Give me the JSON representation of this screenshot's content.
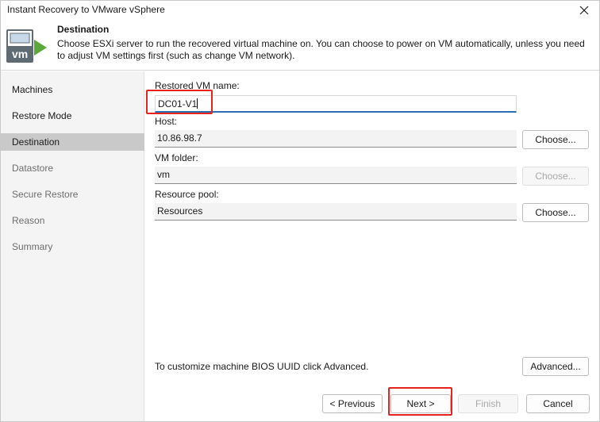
{
  "window": {
    "title": "Instant Recovery to VMware vSphere"
  },
  "header": {
    "title": "Destination",
    "description": "Choose ESXi server to run the recovered virtual machine on. You can choose to power on VM automatically, unless you need to adjust VM settings first (such as change VM network).",
    "icon": "vm-icon"
  },
  "sidebar": {
    "items": [
      {
        "label": "Machines",
        "state": "normal"
      },
      {
        "label": "Restore Mode",
        "state": "normal"
      },
      {
        "label": "Destination",
        "state": "active"
      },
      {
        "label": "Datastore",
        "state": "disabled"
      },
      {
        "label": "Secure Restore",
        "state": "disabled"
      },
      {
        "label": "Reason",
        "state": "disabled"
      },
      {
        "label": "Summary",
        "state": "disabled"
      }
    ]
  },
  "form": {
    "vm_name": {
      "label": "Restored VM name:",
      "value": "DC01-V1"
    },
    "host": {
      "label": "Host:",
      "value": "10.86.98.7",
      "button": "Choose..."
    },
    "vm_folder": {
      "label": "VM folder:",
      "value": "vm",
      "button": "Choose..."
    },
    "resource_pool": {
      "label": "Resource pool:",
      "value": "Resources",
      "button": "Choose..."
    },
    "advanced_text": "To customize machine BIOS UUID click Advanced.",
    "advanced_button": "Advanced..."
  },
  "footer": {
    "previous": "< Previous",
    "next": "Next >",
    "finish": "Finish",
    "cancel": "Cancel"
  },
  "colors": {
    "highlight": "#e8231e",
    "active_nav": "#c9c9c9",
    "logo_green": "#5aa83a",
    "logo_gray": "#5f6b73"
  }
}
